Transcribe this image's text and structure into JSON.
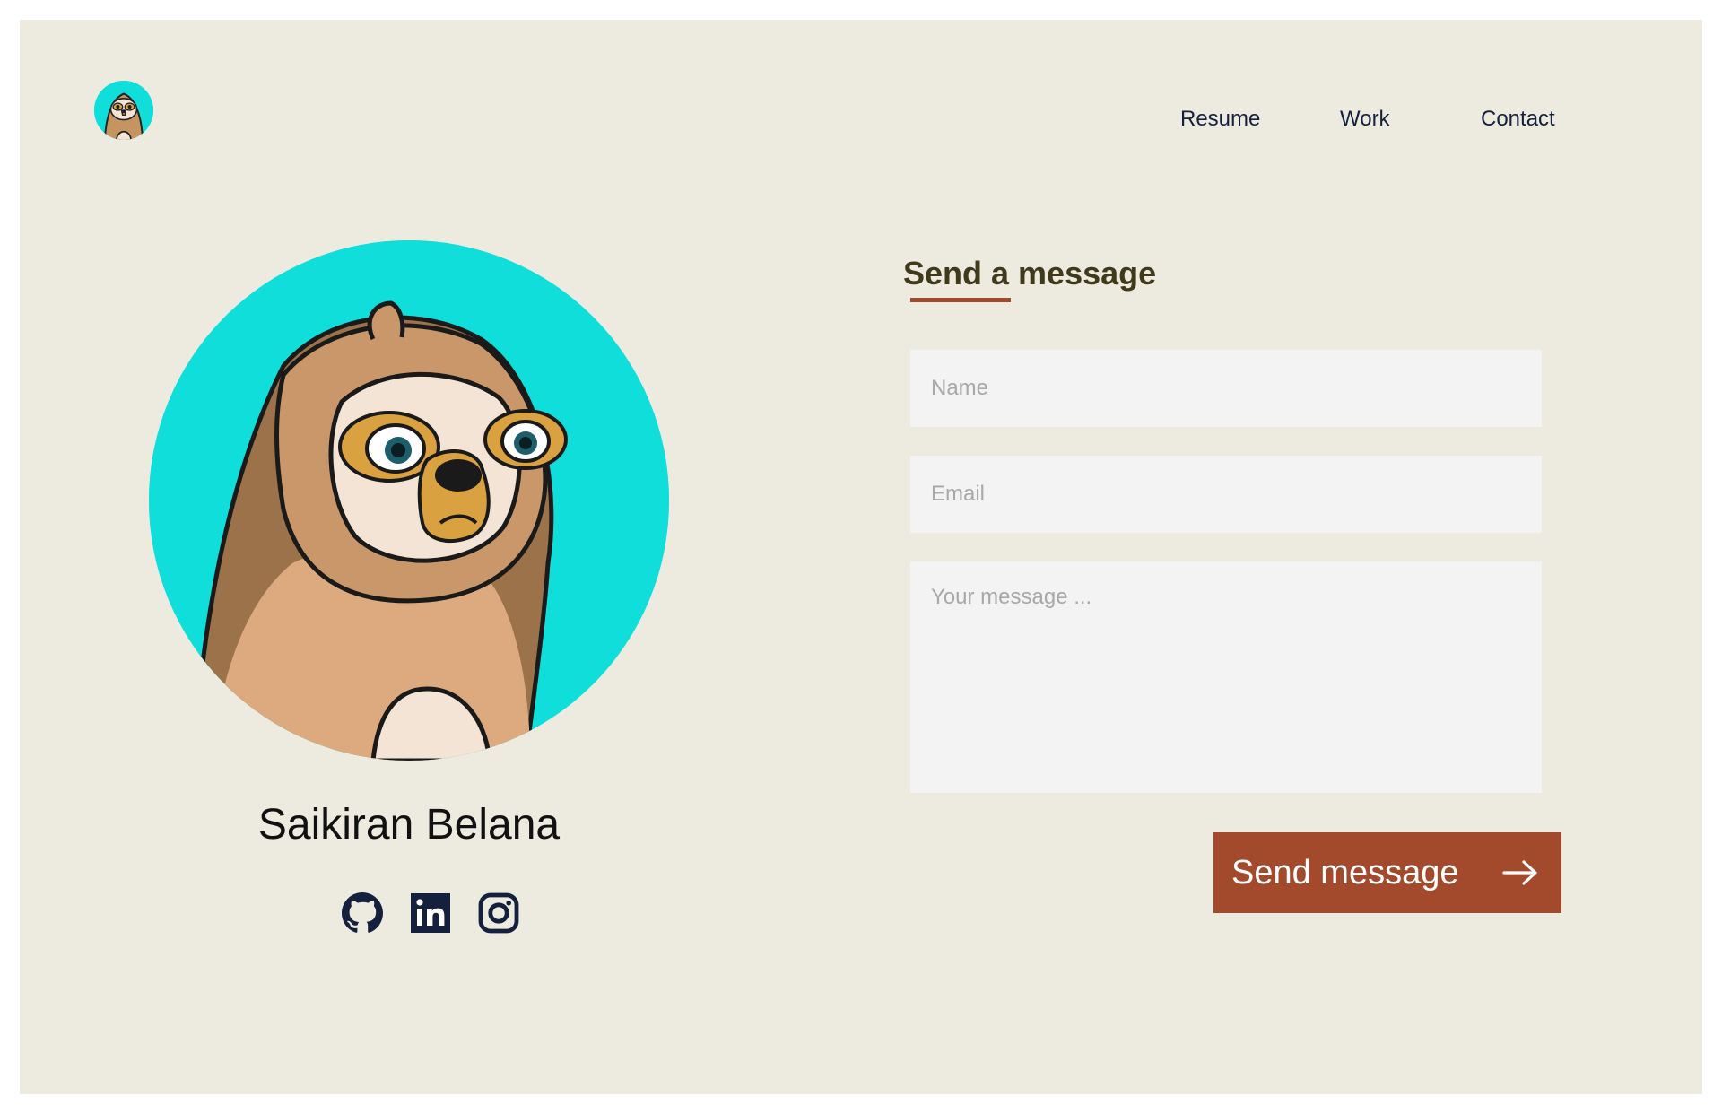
{
  "nav": {
    "items": [
      {
        "label": "Resume"
      },
      {
        "label": "Work"
      },
      {
        "label": "Contact"
      }
    ]
  },
  "profile": {
    "name": "Saikiran Belana",
    "social": [
      "github-icon",
      "linkedin-icon",
      "instagram-icon"
    ]
  },
  "form": {
    "title": "Send a message",
    "name_placeholder": "Name",
    "email_placeholder": "Email",
    "message_placeholder": "Your message ...",
    "submit_label": "Send message"
  },
  "colors": {
    "background": "#edebe0",
    "accent": "#a34a2d",
    "avatar_bg": "#0fdedb",
    "nav_text": "#15203d"
  }
}
